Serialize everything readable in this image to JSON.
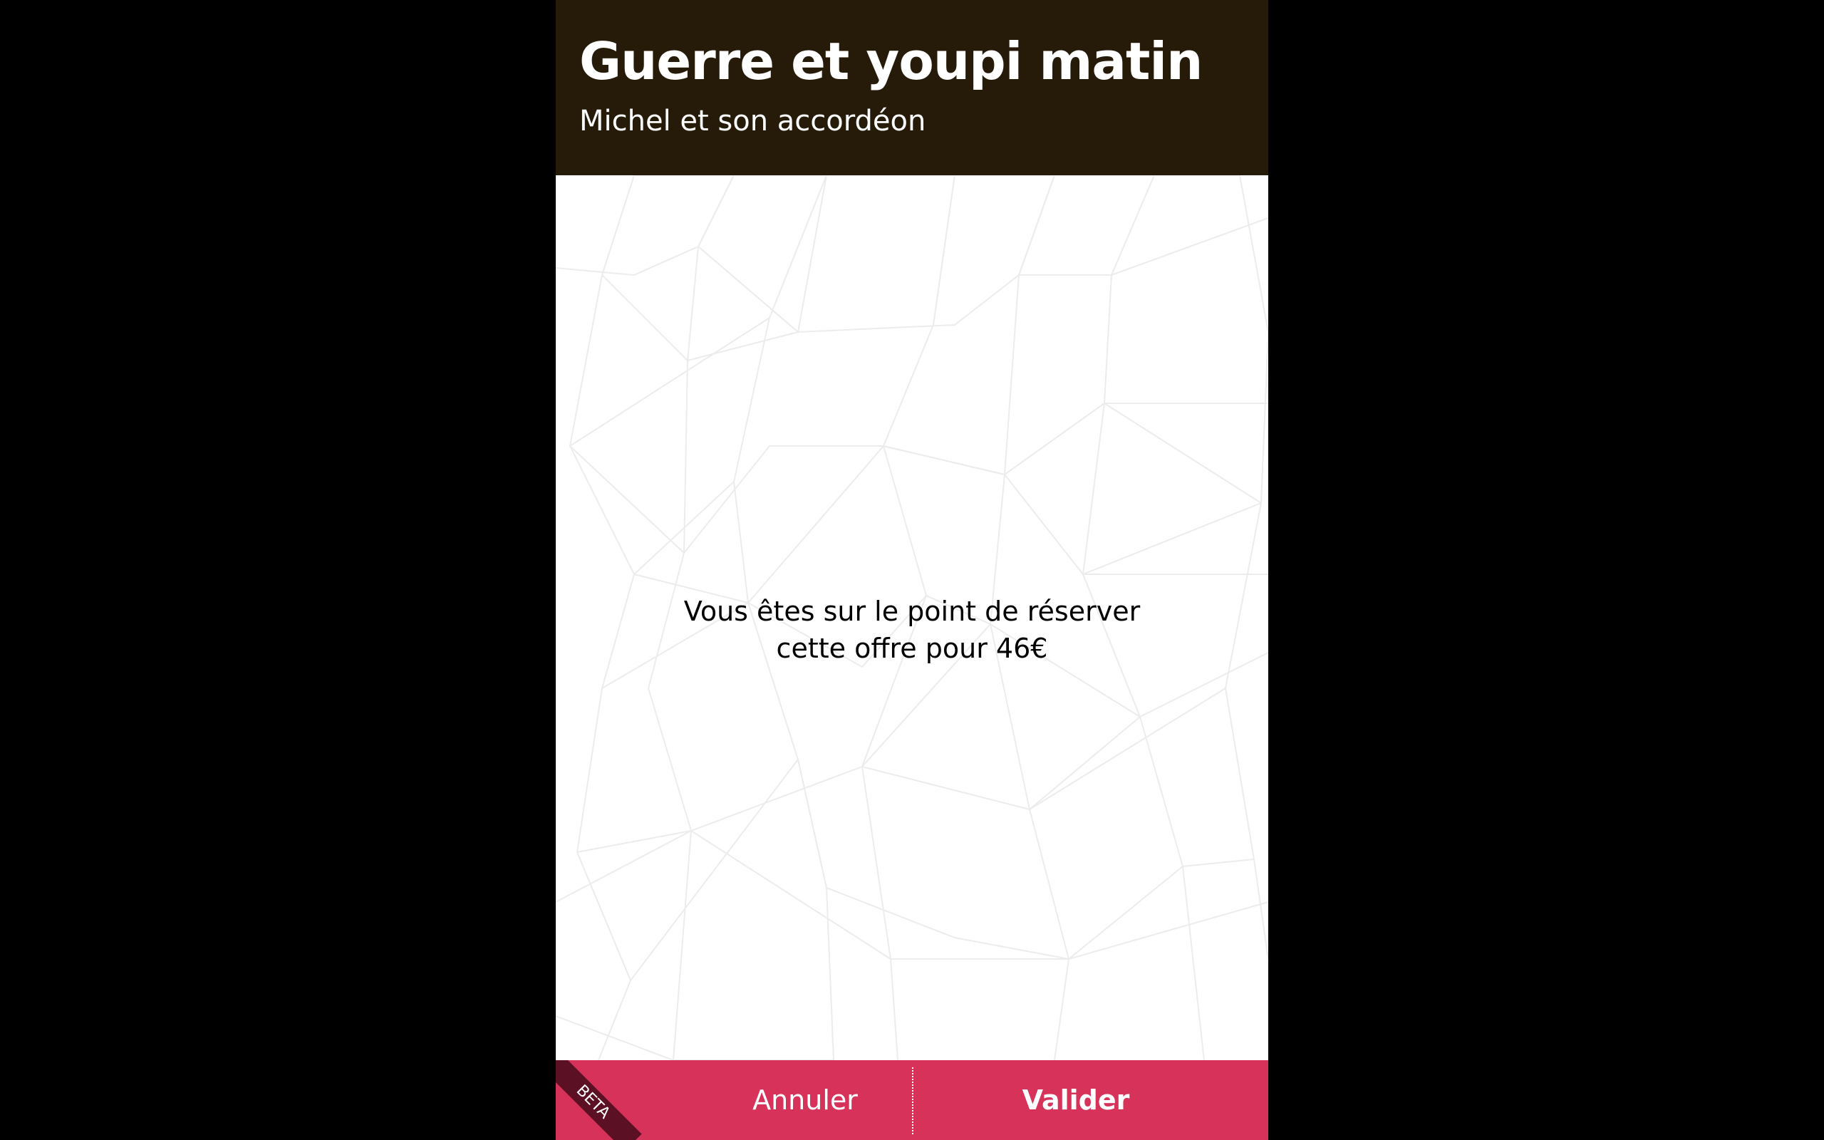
{
  "header": {
    "title": "Guerre et youpi matin",
    "subtitle": "Michel et son accordéon"
  },
  "booking": {
    "message_line1": "Vous êtes sur le point de réserver",
    "message_line2": "cette offre pour 46€"
  },
  "footer": {
    "cancel_label": "Annuler",
    "validate_label": "Valider",
    "beta_label": "BETA"
  },
  "colors": {
    "background": "#000000",
    "header_bg": "#261a09",
    "footer_bg": "#d6325a",
    "beta_ribbon": "#5c1024",
    "pattern_lines": "#ececec"
  },
  "icons": {
    "background_pattern": "low-poly-triangle-pattern"
  }
}
